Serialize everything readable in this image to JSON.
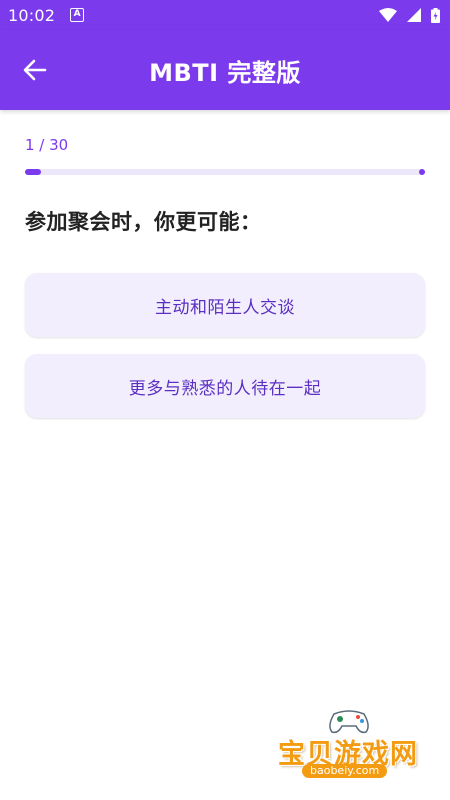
{
  "status_bar": {
    "time": "10:02",
    "notification_icon": "A"
  },
  "app_bar": {
    "back_icon": "arrow-left-icon",
    "title": "MBTI 完整版"
  },
  "progress": {
    "label": "1 / 30",
    "current": 1,
    "total": 30
  },
  "question": {
    "text": "参加聚会时，你更可能："
  },
  "options": [
    {
      "label": "主动和陌生人交谈"
    },
    {
      "label": "更多与熟悉的人待在一起"
    }
  ],
  "watermark": {
    "title": "宝贝游戏网",
    "subtitle": "baobeiy.com"
  },
  "colors": {
    "primary": "#7c3aed",
    "option_bg": "#f2eefd",
    "option_text": "#5a2fc2",
    "watermark": "#f39c12"
  }
}
